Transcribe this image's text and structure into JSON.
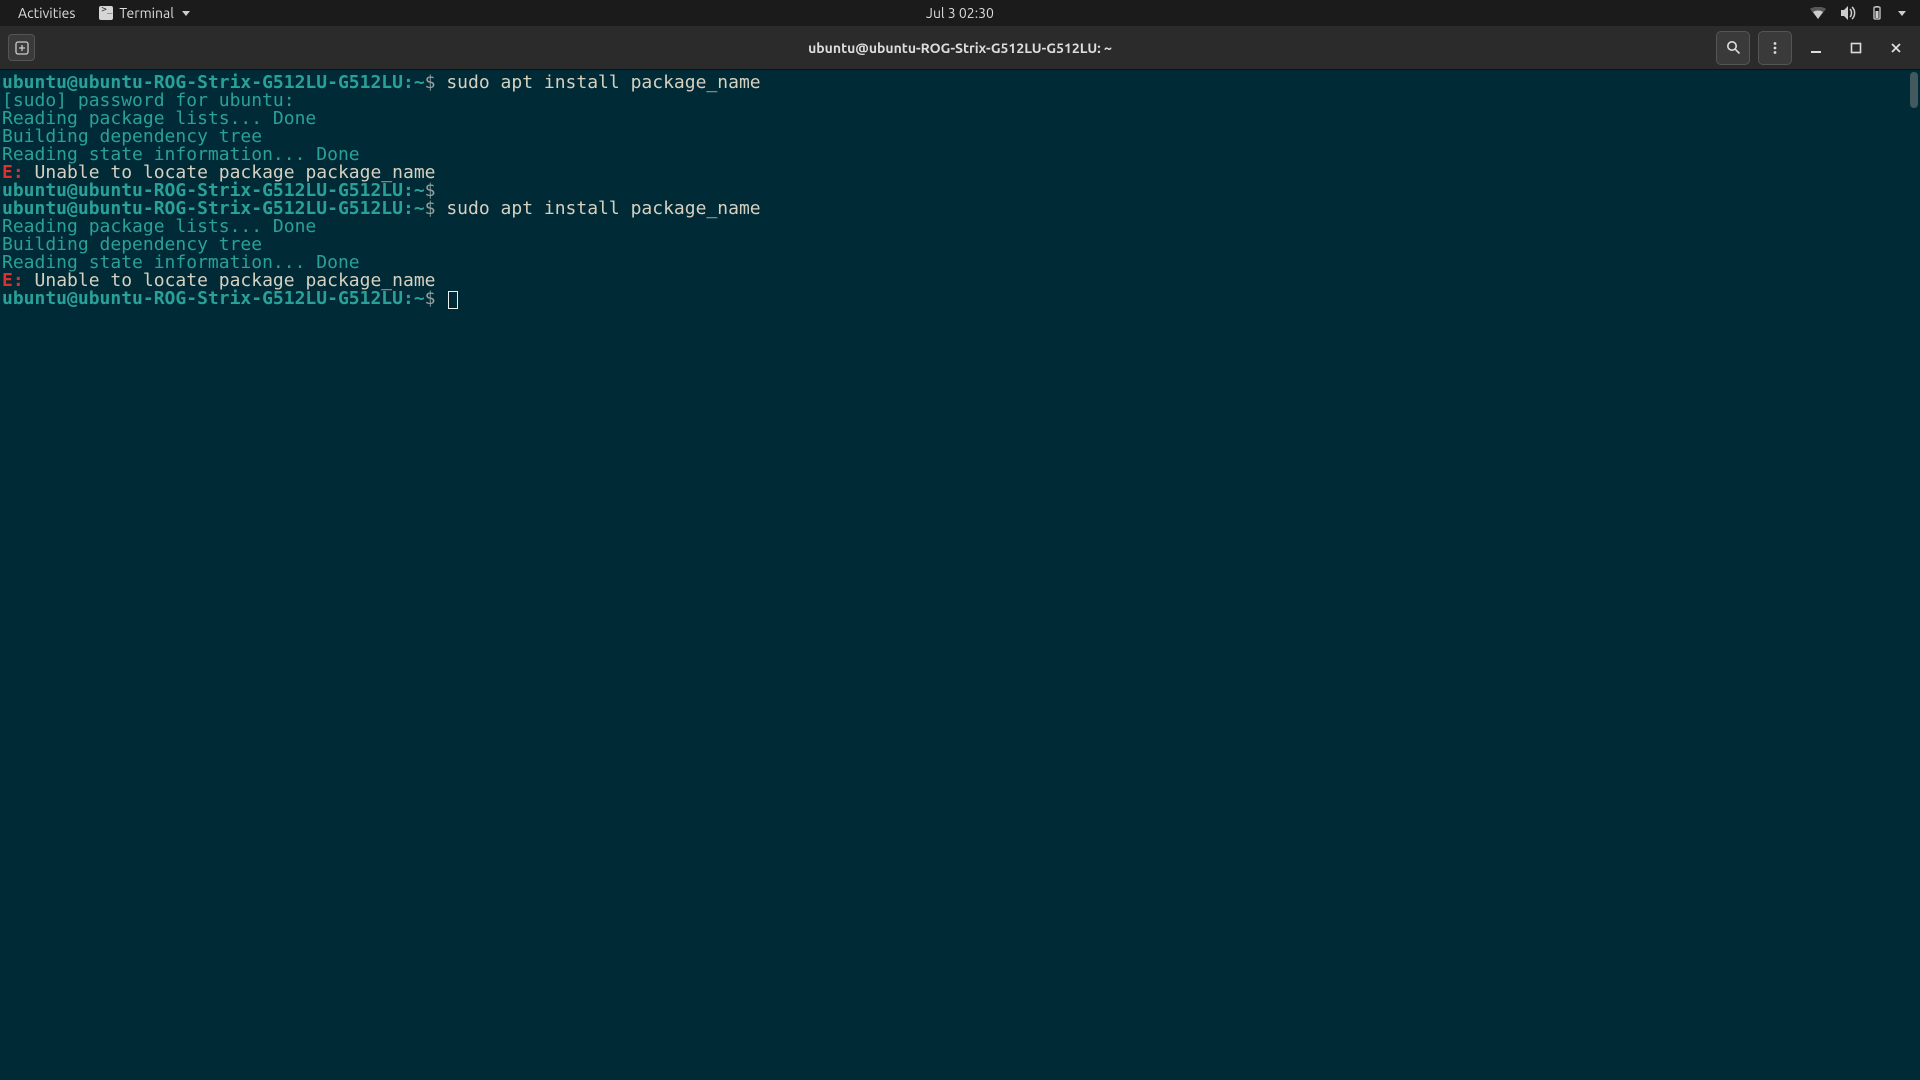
{
  "topbar": {
    "activities": "Activities",
    "app_name": "Terminal",
    "clock": "Jul 3  02:30"
  },
  "window": {
    "title": "ubuntu@ubuntu-ROG-Strix-G512LU-G512LU: ~"
  },
  "prompt": {
    "user_host": "ubuntu@ubuntu-ROG-Strix-G512LU-G512LU",
    "sep": ":",
    "path": "~",
    "symbol": "$"
  },
  "lines": {
    "cmd1": "sudo apt install package_name",
    "sudo_prompt": "[sudo] password for ubuntu:",
    "reading_lists": "Reading package lists... Done",
    "building_tree": "Building dependency tree",
    "reading_state": "Reading state information... Done",
    "err_tag": "E:",
    "err_text": " Unable to locate package package_name",
    "cmd2": "sudo apt install package_name"
  }
}
